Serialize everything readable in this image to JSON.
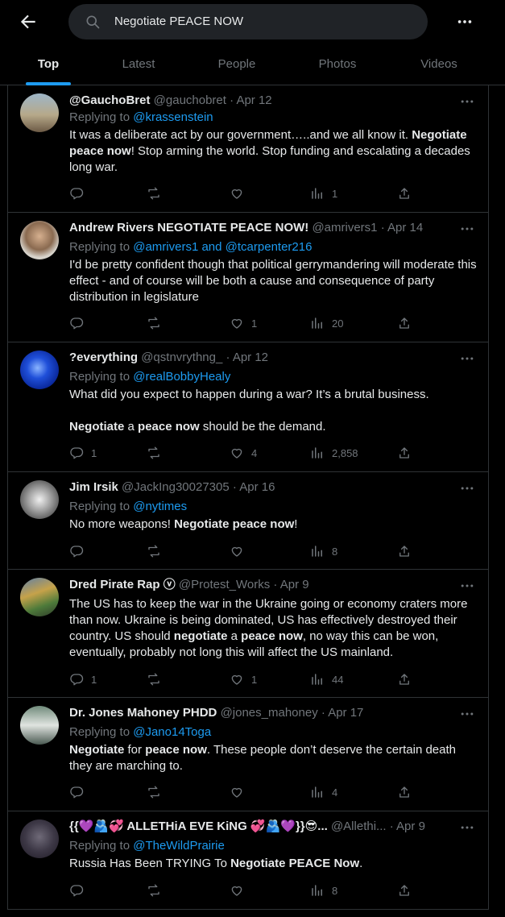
{
  "search": {
    "query": "Negotiate PEACE NOW"
  },
  "tabs": [
    {
      "label": "Top",
      "active": true
    },
    {
      "label": "Latest"
    },
    {
      "label": "People"
    },
    {
      "label": "Photos"
    },
    {
      "label": "Videos"
    }
  ],
  "icons": {
    "back": "arrow-left-icon",
    "search": "search-icon",
    "more": "more-icon",
    "reply": "reply-icon",
    "repost": "repost-icon",
    "like": "like-icon",
    "views": "views-icon",
    "share": "share-icon"
  },
  "colors": {
    "accent": "#1d9bf0",
    "muted": "#71767b",
    "text": "#e7e9ea",
    "border": "#2f3336"
  },
  "reply_prefix": "Replying to",
  "posts": [
    {
      "name": "@GauchoBret",
      "handle": "@gauchobret",
      "date": "· Apr 12",
      "reply_to": "@krassenstein",
      "paras": [
        [
          [
            "It was a deliberate act by our government…..and we all know it.  ",
            false
          ],
          [
            "Negotiate peace now",
            true
          ],
          [
            "!  Stop arming the world.  Stop funding and escalating a decades long war.",
            false
          ]
        ]
      ],
      "replies": "",
      "reposts": "",
      "likes": "",
      "views": "1"
    },
    {
      "name": "Andrew Rivers NEGOTIATE PEACE NOW!",
      "handle": "@amrivers1",
      "date": "· Apr 14",
      "reply_to": "@amrivers1 and @tcarpenter216",
      "paras": [
        [
          [
            "I'd be pretty confident though that political gerrymandering will moderate this effect - and of course will be both a cause and consequence of party distribution in legislature",
            false
          ]
        ]
      ],
      "replies": "",
      "reposts": "",
      "likes": "1",
      "views": "20"
    },
    {
      "name": "?everything",
      "handle": "@qstnvrythng_",
      "date": "· Apr 12",
      "reply_to": "@realBobbyHealy",
      "paras": [
        [
          [
            "What did you expect to happen during a war? It’s a brutal business.",
            false
          ]
        ],
        [
          [
            "Negotiate",
            true
          ],
          [
            " a ",
            false
          ],
          [
            "peace now",
            true
          ],
          [
            " should be the demand.",
            false
          ]
        ]
      ],
      "replies": "1",
      "reposts": "",
      "likes": "4",
      "views": "2,858"
    },
    {
      "name": "Jim Irsik",
      "handle": "@JackIng30027305",
      "date": "· Apr 16",
      "reply_to": "@nytimes",
      "paras": [
        [
          [
            "No more weapons! ",
            false
          ],
          [
            "Negotiate peace now",
            true
          ],
          [
            "!",
            false
          ]
        ]
      ],
      "replies": "",
      "reposts": "",
      "likes": "",
      "views": "8"
    },
    {
      "name": "Dred Pirate Rap ⓥ",
      "handle": "@Protest_Works",
      "date": "· Apr 9",
      "reply_to": "",
      "paras": [
        [
          [
            "The US has to keep the war in the Ukraine going or  economy craters more than now. Ukraine is being dominated, US has effectively destroyed their country. US should ",
            false
          ],
          [
            "negotiate",
            true
          ],
          [
            " a ",
            false
          ],
          [
            "peace now",
            true
          ],
          [
            ", no way this can be won, eventually, probably not long this will affect the US mainland.",
            false
          ]
        ]
      ],
      "replies": "1",
      "reposts": "",
      "likes": "1",
      "views": "44"
    },
    {
      "name": "Dr. Jones Mahoney PHDD",
      "handle": "@jones_mahoney",
      "date": "· Apr 17",
      "reply_to": "@Jano14Toga",
      "paras": [
        [
          [
            "Negotiate",
            true
          ],
          [
            " for ",
            false
          ],
          [
            "peace now",
            true
          ],
          [
            ". These people don’t deserve the certain death they are marching to.",
            false
          ]
        ]
      ],
      "replies": "",
      "reposts": "",
      "likes": "",
      "views": "4"
    },
    {
      "name": "{{💜🫂💞 ALLETHiA EVE KiNG 💞🫂💜}}😎...",
      "handle": "@Allethi...",
      "date": "· Apr 9",
      "reply_to": "@TheWildPrairie",
      "paras": [
        [
          [
            "Russia Has Been TRYING To ",
            false
          ],
          [
            "Negotiate PEACE Now",
            true
          ],
          [
            ".",
            false
          ]
        ]
      ],
      "replies": "",
      "reposts": "",
      "likes": "",
      "views": "8"
    }
  ]
}
